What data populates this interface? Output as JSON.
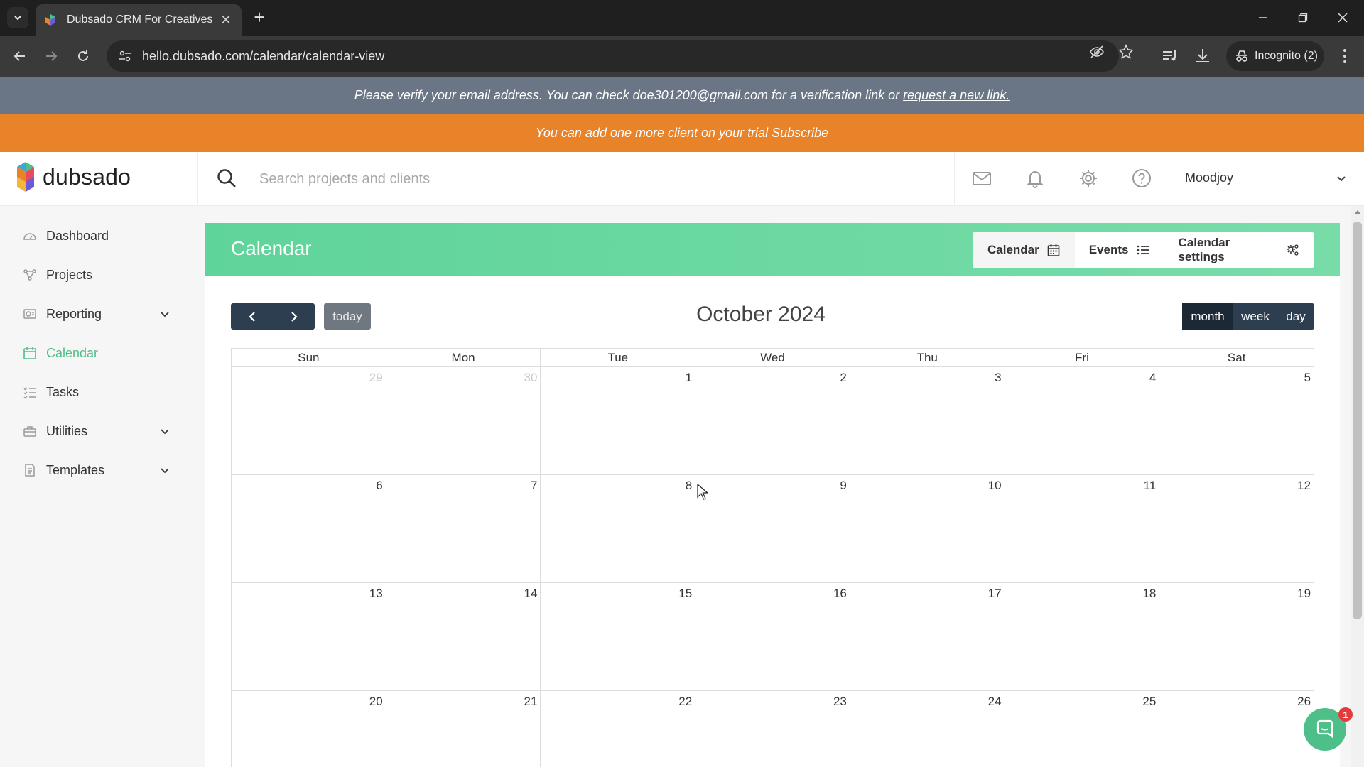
{
  "browser": {
    "tab_title": "Dubsado CRM For Creatives",
    "url": "hello.dubsado.com/calendar/calendar-view",
    "incognito_label": "Incognito (2)"
  },
  "banners": {
    "verify_text": "Please verify your email address. You can check doe301200@gmail.com for a verification link or",
    "verify_link": "request a new link.",
    "trial_text": "You can add one more client on your trial",
    "trial_link": "Subscribe"
  },
  "header": {
    "logo_text": "dubsado",
    "search_placeholder": "Search projects and clients",
    "user_name": "Moodjoy"
  },
  "sidebar": {
    "items": [
      {
        "label": "Dashboard",
        "icon": "dashboard-icon"
      },
      {
        "label": "Projects",
        "icon": "projects-icon"
      },
      {
        "label": "Reporting",
        "icon": "reporting-icon",
        "expandable": true
      },
      {
        "label": "Calendar",
        "icon": "calendar-icon",
        "active": true
      },
      {
        "label": "Tasks",
        "icon": "tasks-icon"
      },
      {
        "label": "Utilities",
        "icon": "utilities-icon",
        "expandable": true
      },
      {
        "label": "Templates",
        "icon": "templates-icon",
        "expandable": true
      }
    ]
  },
  "calendar": {
    "page_title": "Calendar",
    "tabs": {
      "calendar": "Calendar",
      "events": "Events",
      "settings": "Calendar settings"
    },
    "today_label": "today",
    "month_title": "October 2024",
    "views": {
      "month": "month",
      "week": "week",
      "day": "day"
    },
    "active_view": "month",
    "weekdays": [
      "Sun",
      "Mon",
      "Tue",
      "Wed",
      "Thu",
      "Fri",
      "Sat"
    ],
    "weeks": [
      [
        "29",
        "30",
        "1",
        "2",
        "3",
        "4",
        "5"
      ],
      [
        "6",
        "7",
        "8",
        "9",
        "10",
        "11",
        "12"
      ],
      [
        "13",
        "14",
        "15",
        "16",
        "17",
        "18",
        "19"
      ],
      [
        "20",
        "21",
        "22",
        "23",
        "24",
        "25",
        "26"
      ]
    ],
    "other_month_days": [
      "29",
      "30"
    ]
  },
  "chat": {
    "badge_count": "1"
  },
  "colors": {
    "accent_green": "#4fbf89",
    "header_green": "#6ad8a2",
    "trial_orange": "#e8832a",
    "verify_gray": "#6a7685",
    "nav_dark": "#2c3e50"
  }
}
